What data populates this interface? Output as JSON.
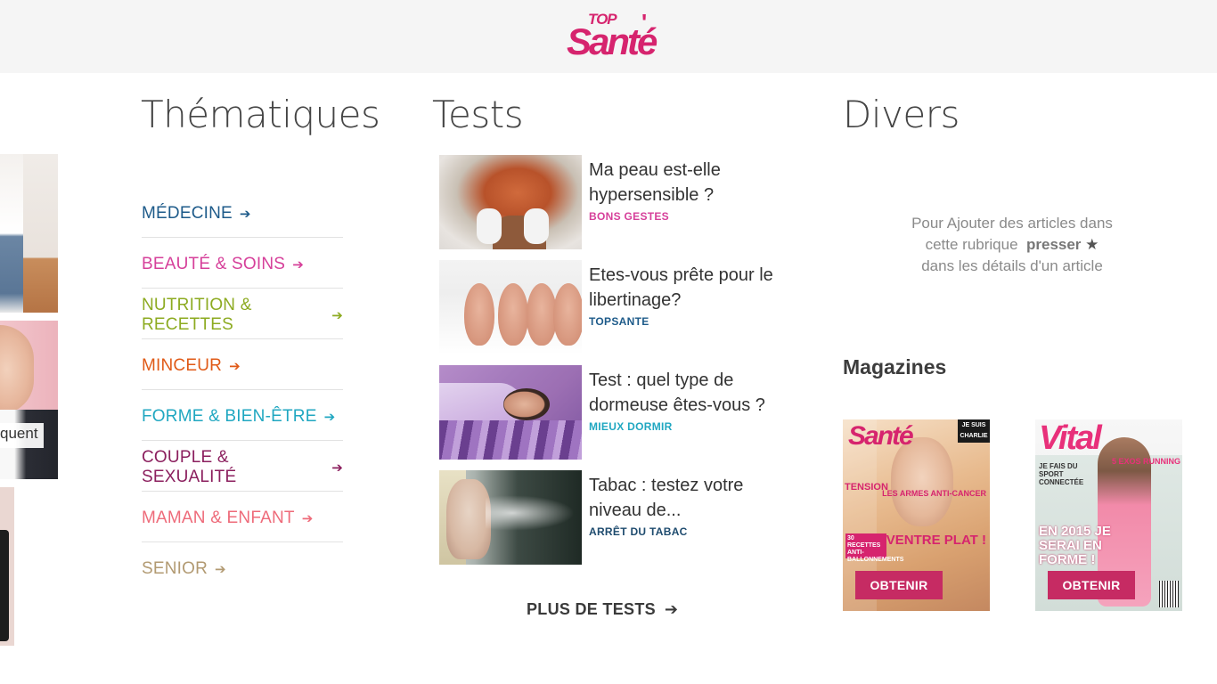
{
  "header": {
    "logo_top": "TOP",
    "logo_main": "Santé"
  },
  "left_tiles": {
    "partial_label": "quent"
  },
  "thematiques": {
    "heading": "Thématiques",
    "items": [
      {
        "label": "MÉDECINE",
        "color": "#1e5b8a"
      },
      {
        "label": "BEAUTÉ & SOINS",
        "color": "#d6409a"
      },
      {
        "label": "NUTRITION & RECETTES",
        "color": "#8dab21"
      },
      {
        "label": "MINCEUR",
        "color": "#e05a17"
      },
      {
        "label": "FORME & BIEN-ÊTRE",
        "color": "#20a7c1"
      },
      {
        "label": "COUPLE & SEXUALITÉ",
        "color": "#8b1f5e"
      },
      {
        "label": "MAMAN & ENFANT",
        "color": "#ee6b7a"
      },
      {
        "label": "SENIOR",
        "color": "#b29a72"
      }
    ]
  },
  "tests": {
    "heading": "Tests",
    "items": [
      {
        "title": "Ma peau est-elle hypersensible ?",
        "category": "BONS GESTES",
        "category_color": "#d6409a"
      },
      {
        "title": "Etes-vous prête pour le libertinage?",
        "category": "TOPSANTE",
        "category_color": "#1e5b8a"
      },
      {
        "title": "Test : quel type de dormeuse êtes-vous ?",
        "category": "MIEUX DORMIR",
        "category_color": "#20a7c1"
      },
      {
        "title": "Tabac : testez votre niveau de...",
        "category": "ARRÊT DU TABAC",
        "category_color": "#1e4b6e"
      }
    ],
    "more_label": "PLUS DE TESTS"
  },
  "divers": {
    "heading": "Divers",
    "hint_line1": "Pour Ajouter des articles dans",
    "hint_line2_pre": "cette rubrique",
    "hint_line2_bold": "presser",
    "hint_line3": "dans les détails d'un article",
    "star_icon": "pin-star-icon"
  },
  "magazines": {
    "heading": "Magazines",
    "items": [
      {
        "cover_title": "Santé",
        "corner": "JE SUIS CHARLIE",
        "headline_a": "TENSION",
        "headline_b": "LES ARMES ANTI-CANCER",
        "headline_c": "VENTRE PLAT !",
        "box": "30 RECETTES ANTI-BALLONNEMENTS",
        "button": "OBTENIR"
      },
      {
        "cover_title": "Vital",
        "headline_a": "EN 2015 JE SERAI EN FORME !",
        "headline_b": "5 EXOS RUNNING",
        "headline_c": "JE FAIS DU SPORT CONNECTÉE",
        "button": "OBTENIR"
      }
    ]
  }
}
